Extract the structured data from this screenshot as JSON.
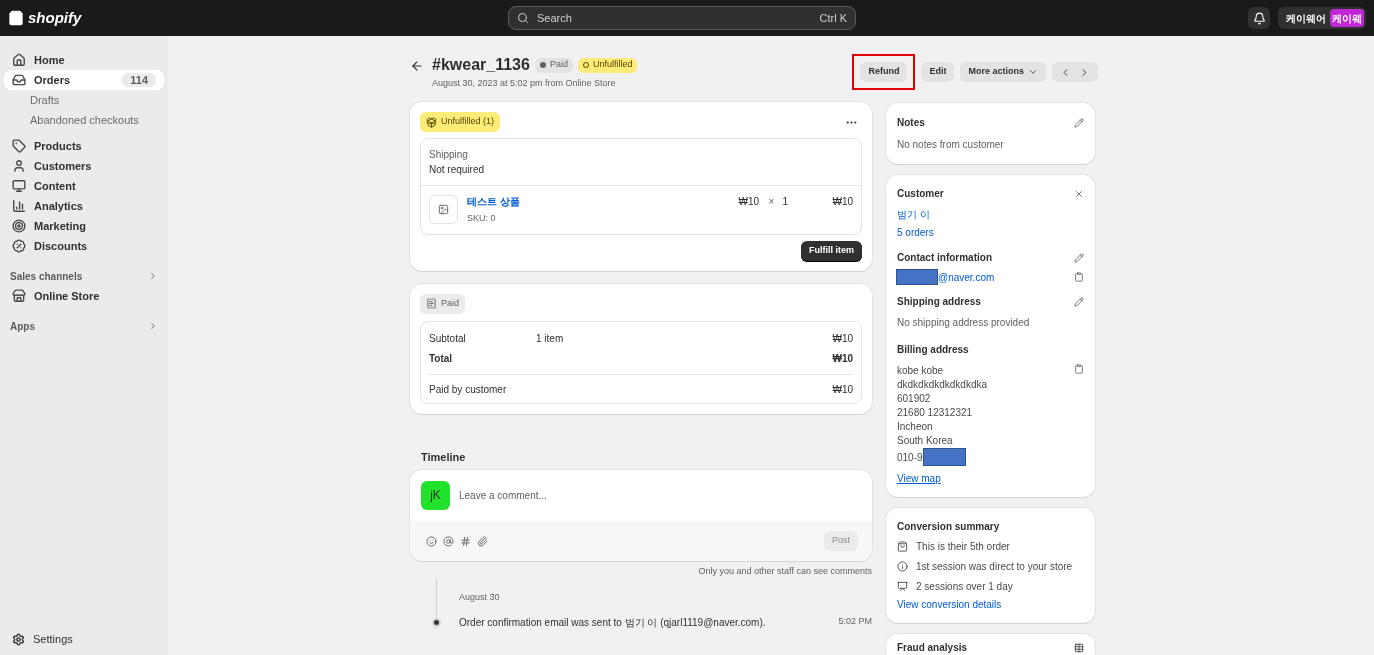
{
  "topbar": {
    "logo": "shopify",
    "search": {
      "placeholder": "Search",
      "shortcut": "Ctrl K"
    },
    "store": {
      "name": "케이웨어",
      "avatar": "케이웨"
    }
  },
  "sidebar": {
    "items": [
      {
        "label": "Home",
        "selected": false
      },
      {
        "label": "Orders",
        "selected": true,
        "count": "114",
        "children": [
          {
            "label": "Drafts",
            "selected": false
          },
          {
            "label": "Abandoned checkouts",
            "selected": false
          }
        ]
      },
      {
        "label": "Products",
        "selected": false
      },
      {
        "label": "Customers",
        "selected": false
      },
      {
        "label": "Content",
        "selected": false
      },
      {
        "label": "Analytics",
        "selected": false
      },
      {
        "label": "Marketing",
        "selected": false
      },
      {
        "label": "Discounts",
        "selected": false
      }
    ],
    "sections": [
      {
        "title": "Sales channels",
        "items": [
          {
            "label": "Online Store",
            "selected": false
          }
        ]
      },
      {
        "title": "Apps"
      }
    ],
    "settings": {
      "label": "Settings",
      "selected": false
    }
  },
  "order": {
    "title": "#kwear_1136",
    "badges": [
      {
        "label": "Paid",
        "kind": "paid"
      },
      {
        "label": "Unfulfilled",
        "kind": "unfulfilled"
      }
    ],
    "subtitle": "August 30, 2023 at 5:02 pm from Online Store",
    "actions": [
      {
        "label": "Refund",
        "highlighted": true,
        "kind": "button"
      },
      {
        "label": "Edit",
        "highlighted": false,
        "kind": "button"
      },
      {
        "label": "More actions",
        "highlighted": false,
        "kind": "menu"
      }
    ]
  },
  "fulfillment": {
    "badge": "Unfulfilled (1)",
    "shipping_label": "Shipping",
    "shipping_value": "Not required",
    "item": {
      "name": "테스트 상품",
      "sku": "SKU: 0",
      "price": "₩10",
      "times": "×",
      "qty": "1",
      "total": "₩10"
    },
    "button": "Fulfill item"
  },
  "payment": {
    "badge": "Paid",
    "rows": [
      {
        "label": "Subtotal",
        "detail": "1 item",
        "amount": "₩10",
        "bold": false
      },
      {
        "label": "Total",
        "detail": "",
        "amount": "₩10",
        "bold": true
      }
    ],
    "paid_label": "Paid by customer",
    "paid_amount": "₩10"
  },
  "timeline": {
    "title": "Timeline",
    "avatar": "jK",
    "placeholder": "Leave a comment...",
    "post": "Post",
    "note": "Only you and other staff can see comments",
    "date": "August 30",
    "events": [
      {
        "text": "Order confirmation email was sent to 범기 이 (qjarl1119@naver.com).",
        "time": "5:02 PM"
      }
    ]
  },
  "notes": {
    "title": "Notes",
    "text": "No notes from customer"
  },
  "customer": {
    "title": "Customer",
    "name": "범기 이",
    "orders": "5 orders",
    "contact_title": "Contact information",
    "email": "@naver.com",
    "shipping_title": "Shipping address",
    "shipping_text": "No shipping address provided",
    "billing_title": "Billing address",
    "billing_lines": [
      "kobe kobe",
      "dkdkdkdkdkdkdkdka",
      "601902",
      "21680 12312321",
      "Incheon",
      "South Korea"
    ],
    "phone": "010-9",
    "map_link": "View map"
  },
  "conversion": {
    "title": "Conversion summary",
    "items": [
      {
        "text": "This is their 5th order"
      },
      {
        "text": "1st session was direct to your store"
      },
      {
        "text": "2 sessions over 1 day"
      }
    ],
    "link": "View conversion details"
  },
  "fraud": {
    "title": "Fraud analysis"
  }
}
